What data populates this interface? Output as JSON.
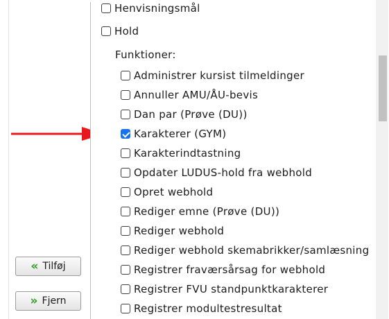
{
  "list": {
    "items_top": [
      {
        "label": "Henvisningsmål",
        "checked": false
      },
      {
        "label": "Hold",
        "checked": false
      }
    ],
    "functions_label": "Funktioner:",
    "functions": [
      {
        "label": "Administrer kursist tilmeldinger",
        "checked": false
      },
      {
        "label": "Annuller AMU/ÅU-bevis",
        "checked": false
      },
      {
        "label": "Dan par (Prøve (DU))",
        "checked": false
      },
      {
        "label": "Karakterer (GYM)",
        "checked": true
      },
      {
        "label": "Karakterindtastning",
        "checked": false
      },
      {
        "label": "Opdater LUDUS-hold fra webhold",
        "checked": false
      },
      {
        "label": "Opret webhold",
        "checked": false
      },
      {
        "label": "Rediger emne (Prøve (DU))",
        "checked": false
      },
      {
        "label": "Rediger webhold",
        "checked": false
      },
      {
        "label": "Rediger webhold skemabrikker/samlæsning",
        "checked": false
      },
      {
        "label": "Registrer fraværsårsag for webhold",
        "checked": false
      },
      {
        "label": "Registrer FVU standpunktkarakterer",
        "checked": false
      },
      {
        "label": "Registrer modultestresultat",
        "checked": false
      }
    ]
  },
  "buttons": {
    "add_label": "Tilføj",
    "add_icon": "double-chevron-left-icon",
    "remove_label": "Fjern",
    "remove_icon": "double-chevron-right-icon"
  },
  "annotation": {
    "arrow_color": "#e8191c"
  }
}
